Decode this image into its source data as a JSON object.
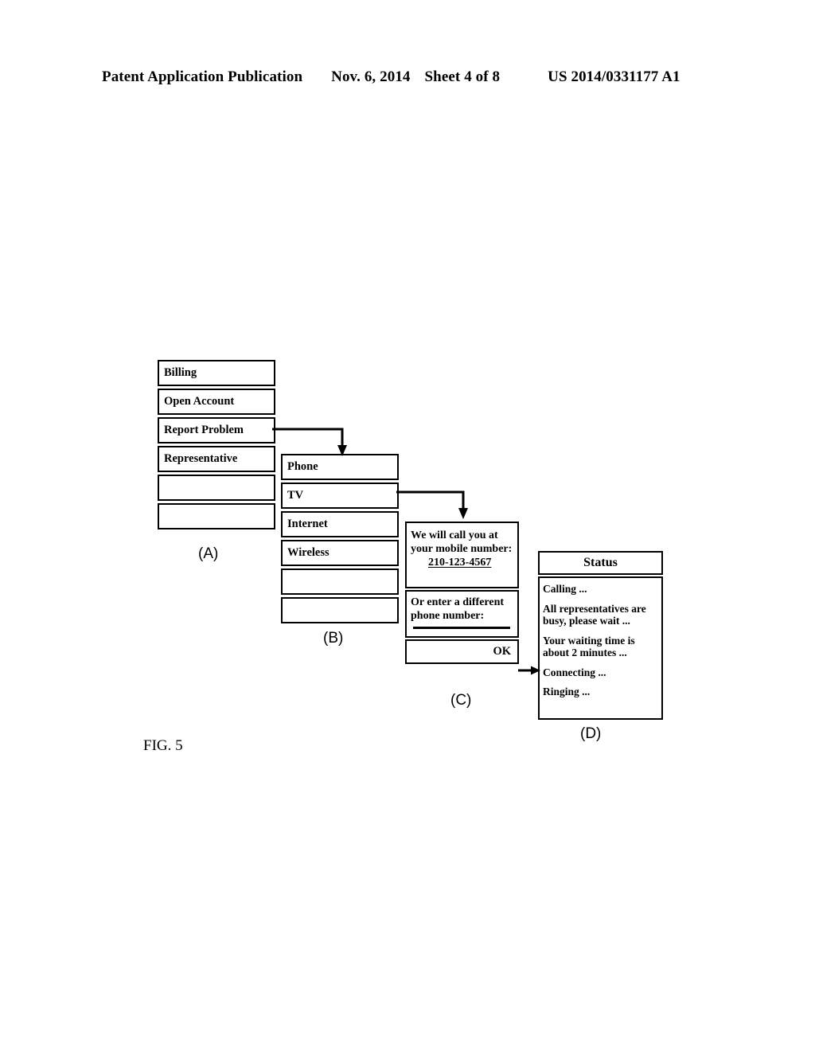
{
  "header": {
    "publication": "Patent Application Publication",
    "date": "Nov. 6, 2014",
    "sheet": "Sheet 4 of 8",
    "patent_number": "US 2014/0331177 A1"
  },
  "figure": {
    "label": "FIG. 5",
    "panels": {
      "a": {
        "caption": "(A)",
        "items": [
          {
            "label": "Billing"
          },
          {
            "label": "Open Account"
          },
          {
            "label": "Report Problem"
          },
          {
            "label": "Representative"
          },
          {
            "label": ""
          },
          {
            "label": ""
          }
        ]
      },
      "b": {
        "caption": "(B)",
        "items": [
          {
            "label": "Phone"
          },
          {
            "label": "TV"
          },
          {
            "label": "Internet"
          },
          {
            "label": "Wireless"
          },
          {
            "label": ""
          },
          {
            "label": ""
          }
        ]
      },
      "c": {
        "caption": "(C)",
        "message": "We will call you at your mobile number:",
        "phone_number": "210-123-4567",
        "entry_prompt": "Or enter a different phone number:",
        "entry_value": "",
        "ok_label": "OK"
      },
      "d": {
        "caption": "(D)",
        "title": "Status",
        "status_lines": [
          "Calling ...",
          "All representatives are busy, please wait ...",
          "Your waiting time is about 2 minutes ...",
          "Connecting ...",
          "Ringing ..."
        ]
      }
    },
    "connectors": [
      {
        "name": "report-problem-to-panel-b"
      },
      {
        "name": "tv-to-panel-c"
      },
      {
        "name": "ok-to-panel-d"
      }
    ]
  },
  "colors": {
    "ink": "#000000",
    "paper": "#ffffff"
  }
}
